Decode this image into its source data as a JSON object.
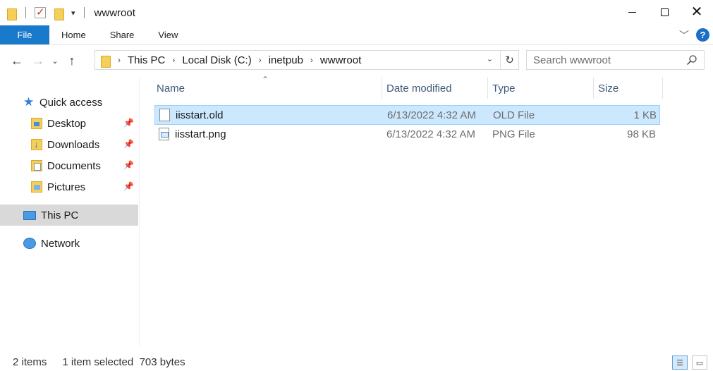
{
  "window": {
    "title": "wwwroot"
  },
  "ribbon": {
    "tabs": [
      "File",
      "Home",
      "Share",
      "View"
    ]
  },
  "address": {
    "crumbs": [
      "This PC",
      "Local Disk (C:)",
      "inetpub",
      "wwwroot"
    ]
  },
  "search": {
    "placeholder": "Search wwwroot"
  },
  "nav": {
    "quick_access": "Quick access",
    "items": [
      {
        "label": "Desktop",
        "pinned": true
      },
      {
        "label": "Downloads",
        "pinned": true
      },
      {
        "label": "Documents",
        "pinned": true
      },
      {
        "label": "Pictures",
        "pinned": true
      }
    ],
    "this_pc": "This PC",
    "network": "Network"
  },
  "columns": {
    "name": "Name",
    "date": "Date modified",
    "type": "Type",
    "size": "Size"
  },
  "files": [
    {
      "name": "iisstart.old",
      "date": "6/13/2022 4:32 AM",
      "type": "OLD File",
      "size": "1 KB",
      "selected": true
    },
    {
      "name": "iisstart.png",
      "date": "6/13/2022 4:32 AM",
      "type": "PNG File",
      "size": "98 KB",
      "selected": false
    }
  ],
  "status": {
    "count": "2 items",
    "selection": "1 item selected  703 bytes"
  },
  "colors": {
    "accent": "#1979ca",
    "selection": "#cce8ff",
    "selection_border": "#99d1ff"
  }
}
